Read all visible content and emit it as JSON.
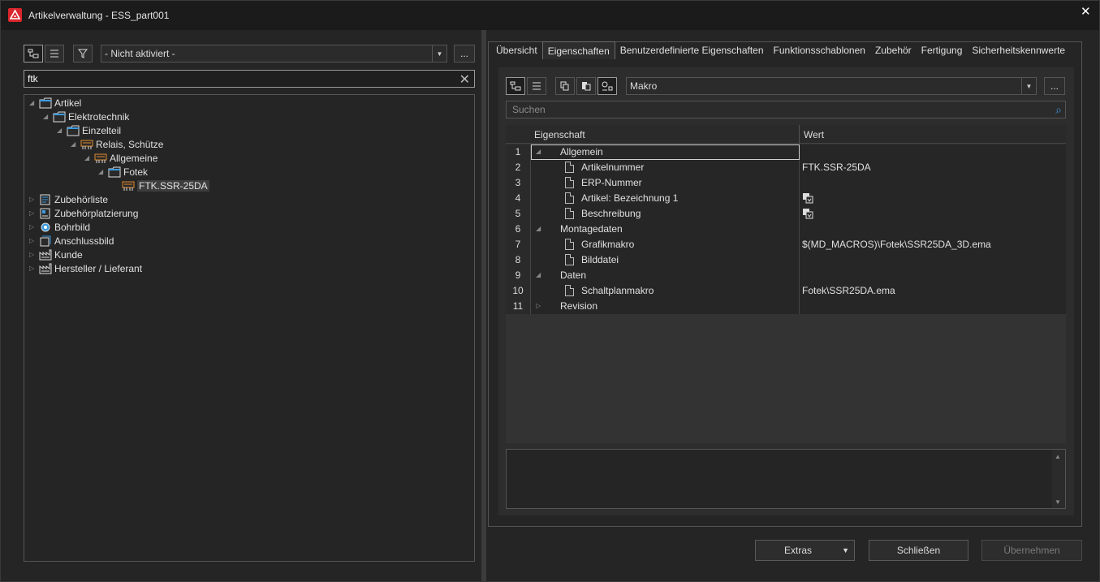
{
  "window": {
    "title": "Artikelverwaltung - ESS_part001",
    "close_glyph": "✕"
  },
  "left": {
    "filter_combo": "- Nicht aktiviert -",
    "more_button": "...",
    "search_value": "ftk",
    "tree": [
      {
        "label": "Artikel",
        "level": 0,
        "expanded": true,
        "icon": "folder-icon"
      },
      {
        "label": "Elektrotechnik",
        "level": 1,
        "expanded": true,
        "icon": "folder-icon"
      },
      {
        "label": "Einzelteil",
        "level": 2,
        "expanded": true,
        "icon": "folder-icon"
      },
      {
        "label": "Relais, Schütze",
        "level": 3,
        "expanded": true,
        "icon": "relay-icon"
      },
      {
        "label": "Allgemeine",
        "level": 4,
        "expanded": true,
        "icon": "relay-icon"
      },
      {
        "label": "Fotek",
        "level": 5,
        "expanded": true,
        "icon": "folder-icon"
      },
      {
        "label": "FTK.SSR-25DA",
        "level": 6,
        "selected": true,
        "icon": "relay-icon"
      },
      {
        "label": "Zubehörliste",
        "level": 0,
        "expanded": false,
        "icon": "list-icon"
      },
      {
        "label": "Zubehörplatzierung",
        "level": 0,
        "expanded": false,
        "icon": "placement-icon"
      },
      {
        "label": "Bohrbild",
        "level": 0,
        "expanded": false,
        "icon": "drill-icon"
      },
      {
        "label": "Anschlussbild",
        "level": 0,
        "expanded": false,
        "icon": "connection-icon"
      },
      {
        "label": "Kunde",
        "level": 0,
        "expanded": false,
        "icon": "factory-icon"
      },
      {
        "label": "Hersteller / Lieferant",
        "level": 0,
        "expanded": false,
        "icon": "factory-icon"
      }
    ]
  },
  "tabs": [
    "Übersicht",
    "Eigenschaften",
    "Benutzerdefinierte Eigenschaften",
    "Funktionsschablonen",
    "Zubehör",
    "Fertigung",
    "Sicherheitskennwerte"
  ],
  "active_tab": 1,
  "props": {
    "combo": "Makro",
    "more_button": "...",
    "search_placeholder": "Suchen",
    "col_property": "Eigenschaft",
    "col_value": "Wert",
    "rows": [
      {
        "num": "1",
        "name": "Allgemein",
        "value": "",
        "type": "group",
        "expanded": true
      },
      {
        "num": "2",
        "name": "Artikelnummer",
        "value": "FTK.SSR-25DA",
        "type": "item"
      },
      {
        "num": "3",
        "name": "ERP-Nummer",
        "value": "",
        "type": "item"
      },
      {
        "num": "4",
        "name": "Artikel: Bezeichnung 1",
        "value": "",
        "type": "item",
        "value_icon": true
      },
      {
        "num": "5",
        "name": "Beschreibung",
        "value": "",
        "type": "item",
        "value_icon": true
      },
      {
        "num": "6",
        "name": "Montagedaten",
        "value": "",
        "type": "group",
        "expanded": true
      },
      {
        "num": "7",
        "name": "Grafikmakro",
        "value": "$(MD_MACROS)\\Fotek\\SSR25DA_3D.ema",
        "type": "item"
      },
      {
        "num": "8",
        "name": "Bilddatei",
        "value": "",
        "type": "item"
      },
      {
        "num": "9",
        "name": "Daten",
        "value": "",
        "type": "group",
        "expanded": true
      },
      {
        "num": "10",
        "name": "Schaltplanmakro",
        "value": "Fotek\\SSR25DA.ema",
        "type": "item"
      },
      {
        "num": "11",
        "name": "Revision",
        "value": "",
        "type": "group",
        "expanded": false
      }
    ]
  },
  "buttons": {
    "extras": "Extras",
    "close": "Schließen",
    "apply": "Übernehmen"
  }
}
